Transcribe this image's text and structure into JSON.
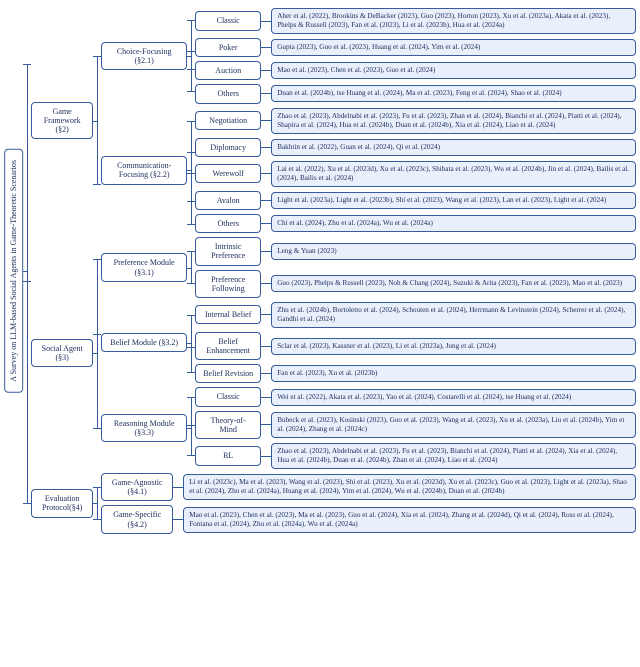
{
  "root": "A Survey on LLM-based Social Agents in Game-Theoretic Scenarios",
  "l1": {
    "game": "Game Framework (§2)",
    "agent": "Social Agent (§3)",
    "eval": "Evaluation Protocol(§4)"
  },
  "game": {
    "choice": "Choice-Focusing (§2.1)",
    "comm": "Communication-Focusing (§2.2)"
  },
  "choice": {
    "classic": "Classic",
    "classic_refs": "Aher et al. (2022), Brookins & DeBacker (2023), Guo (2023), Horton (2023), Xu et al. (2023a), Akata et al. (2023), Phelps & Russell (2023), Fan et al. (2023), Li et al. (2023b), Hua et al. (2024a)",
    "poker": "Poker",
    "poker_refs": "Gupta (2023), Guo et al. (2023), Huang et al. (2024), Yim et al. (2024)",
    "auction": "Auction",
    "auction_refs": "Mao et al. (2023), Chen et al. (2023), Guo et al. (2024)",
    "others": "Others",
    "others_refs": "Duan et al. (2024b), tse Huang et al. (2024), Ma et al. (2023), Feng et al. (2024), Shao et al. (2024)"
  },
  "comm": {
    "neg": "Negotiation",
    "neg_refs": "Zhao et al. (2023), Abdelnabi et al. (2023), Fu et al. (2023), Zhan et al. (2024), Bianchi et al. (2024), Piatti et al. (2024), Shapira et al. (2024), Hua et al. (2024b), Duan et al. (2024b), Xia et al. (2024), Liao et al. (2024)",
    "dip": "Diplomacy",
    "dip_refs": "Bakhtin et al. (2022), Guan et al. (2024), Qi et al. (2024)",
    "wolf": "Werewolf",
    "wolf_refs": "Lai et al. (2022), Xu et al. (2023d), Xu et al. (2023c), Shibata et al. (2023), Wu et al. (2024b), Jin et al. (2024), Bailis et al. (2024), Bailis et al. (2024)",
    "avalon": "Avalon",
    "avalon_refs": "Light et al. (2023a), Light et al. (2023b), Shi et al. (2023), Wang et al. (2023), Lan et al. (2023), Light et al. (2024)",
    "others": "Others",
    "others_refs": "Chi et al. (2024), Zhu et al. (2024a), Wu et al. (2024a)"
  },
  "agent": {
    "pref": "Preference Module (§3.1)",
    "belief": "Belief Module (§3.2)",
    "reason": "Reasoning Module (§3.3)"
  },
  "pref": {
    "intr": "Intrinsic Preference",
    "intr_refs": "Leng & Yuan (2023)",
    "follow": "Preference Following",
    "follow_refs": "Guo (2023), Phelps & Russell (2023), Noh & Chang (2024), Suzuki & Arita (2023), Fan et al. (2023), Mao et al. (2023)"
  },
  "belief": {
    "int": "Internal Belief",
    "int_refs": "Zhu et al. (2024b), Bortoletto et al. (2024), Schouten et al. (2024), Herrmann & Levinstein (2024), Scherrer et al. (2024), Gandhi et al. (2024)",
    "enh": "Belief Enhancement",
    "enh_refs": "Sclar et al. (2023), Kassner et al. (2023), Li et al. (2023a), Jung et al. (2024)",
    "rev": "Belief Revision",
    "rev_refs": "Fan et al. (2023), Xu et al. (2023b)"
  },
  "reason": {
    "classic": "Classic",
    "classic_refs": "Wei et al. (2022), Akata et al. (2023), Yao et al. (2024), Costarelli et al. (2024), tse Huang et al. (2024)",
    "tom": "Theory-of-Mind",
    "tom_refs": "Bubeck et al. (2023), Kosinski (2023), Guo et al. (2023), Wang et al. (2023), Xu et al. (2023a), Liu et al. (2024b), Yim et al. (2024), Zhang et al. (2024c)",
    "rl": "RL",
    "rl_refs": "Zhao et al. (2023), Abdelnabi et al. (2023), Fu et al. (2023), Bianchi et al. (2024), Piatti et al. (2024), Xia et al. (2024), Hua et al. (2024b), Duan et al. (2024b), Zhan et al. (2024), Liao et al. (2024)"
  },
  "eval": {
    "agn": "Game-Agnostic (§4.1)",
    "agn_refs": "Li et al. (2023c), Ma et al. (2023), Wang et al. (2023), Shi et al. (2023), Xu et al. (2023d), Xu et al. (2023c), Guo et al. (2023), Light et al. (2023a), Shao et al. (2024), Zhu et al. (2024a), Huang et al. (2024), Yim et al. (2024), Wu et al. (2024b), Duan et al. (2024b)",
    "spec": "Game-Specific (§4.2)",
    "spec_refs": "Mao et al. (2023), Chen et al. (2023), Ma et al. (2023), Guo et al. (2024), Xia et al. (2024), Zhang et al. (2024d), Qi et al. (2024), Ross et al. (2024), Fontana et al. (2024), Zhu et al. (2024a), Wu et al. (2024a)"
  }
}
